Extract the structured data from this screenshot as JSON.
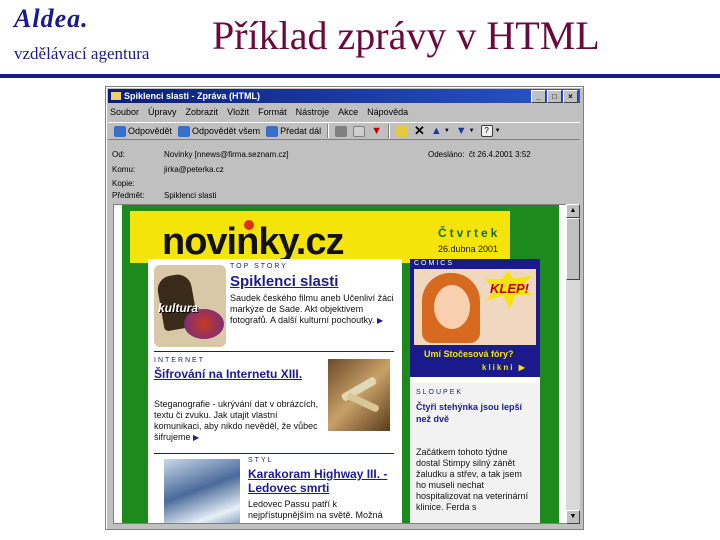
{
  "slide": {
    "logo": "Aldea.",
    "subtitle": "vzdělávací agentura",
    "title": "Příklad zprávy v HTML"
  },
  "window": {
    "title": "Spiklenci slasti - Zpráva (HTML)",
    "controls": [
      "_",
      "□",
      "×"
    ],
    "menu": [
      "Soubor",
      "Úpravy",
      "Zobrazit",
      "Vložit",
      "Formát",
      "Nástroje",
      "Akce",
      "Nápověda"
    ],
    "toolbar": {
      "reply": "Odpovědět",
      "reply_all": "Odpovědět všem",
      "forward": "Předat dál"
    },
    "headers": {
      "from_label": "Od:",
      "from_value": "Novinky [nnews@firma.seznam.cz]",
      "to_label": "Komu:",
      "to_value": "jirka@peterka.cz",
      "cc_label": "Kopie:",
      "cc_value": "",
      "subject_label": "Předmět:",
      "subject_value": "Spiklenci slasti",
      "sent_label": "Odesláno:",
      "sent_value": "čt 26.4.2001 3:52"
    }
  },
  "newsletter": {
    "logo": "novinky.cz",
    "day": "Čtvrtek",
    "date": "26.dubna 2001",
    "top_story": {
      "kicker": "TOP STORY",
      "headline": "Spiklenci slasti",
      "image_label": "kultura",
      "text": "Saudek českého filmu aneb Učenliví žáci markýze de Sade. Akt objektivem fotografů. A další kulturní pochoutky."
    },
    "internet": {
      "kicker": "INTERNET",
      "headline": "Šifrování na Internetu XIII.",
      "text": "Steganografie - ukrývání dat v obrázcích, textu či zvuku. Jak utajit vlastní komunikaci, aby nikdo nevěděl, že vůbec šifrujeme"
    },
    "styl": {
      "kicker": "STYL",
      "headline": "Karakoram Highway III. - Ledovec smrti",
      "text": "Ledovec Passu patří k nejpřístupnějším na světě. Možná"
    },
    "comics": {
      "kicker": "COMICS",
      "burst": "KLEP!",
      "question": "Umí Stočesová fóry?",
      "link": "klikni"
    },
    "sloupek": {
      "kicker": "SLOUPEK",
      "headline": "Čtyři stehýnka jsou lepší než dvě",
      "text": "Začátkem tohoto týdne dostal Stimpy silný zánět žaludku a střev, a tak jsem ho museli nechat hospitalizovat na veterinární klinice. Ferda s"
    }
  },
  "colors": {
    "slide_blue": "#1a1a8c",
    "slide_title": "#6a0a3c",
    "newsletter_green": "#1c8a1c",
    "newsletter_yellow": "#f4e40a",
    "comics_blue": "#1a1a8c"
  }
}
